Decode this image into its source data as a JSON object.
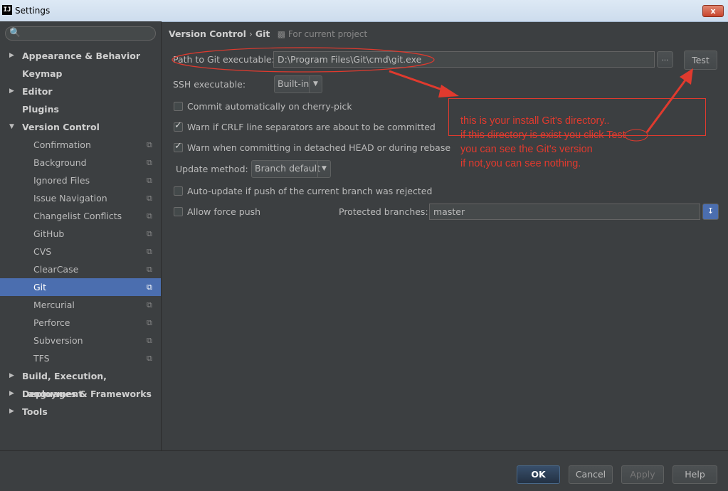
{
  "window": {
    "title": "Settings",
    "app_icon": "IJ",
    "close_label": "x"
  },
  "search": {
    "placeholder": ""
  },
  "sidebar": {
    "items": [
      {
        "label": "Appearance & Behavior",
        "level": 1,
        "arrow": "▶"
      },
      {
        "label": "Keymap",
        "level": 1,
        "arrow": ""
      },
      {
        "label": "Editor",
        "level": 1,
        "arrow": "▶"
      },
      {
        "label": "Plugins",
        "level": 1,
        "arrow": ""
      },
      {
        "label": "Version Control",
        "level": 1,
        "arrow": "▼"
      },
      {
        "label": "Confirmation",
        "level": 2
      },
      {
        "label": "Background",
        "level": 2
      },
      {
        "label": "Ignored Files",
        "level": 2
      },
      {
        "label": "Issue Navigation",
        "level": 2
      },
      {
        "label": "Changelist Conflicts",
        "level": 2
      },
      {
        "label": "GitHub",
        "level": 2
      },
      {
        "label": "CVS",
        "level": 2
      },
      {
        "label": "ClearCase",
        "level": 2
      },
      {
        "label": "Git",
        "level": 2,
        "selected": true
      },
      {
        "label": "Mercurial",
        "level": 2
      },
      {
        "label": "Perforce",
        "level": 2
      },
      {
        "label": "Subversion",
        "level": 2
      },
      {
        "label": "TFS",
        "level": 2
      },
      {
        "label": "Build, Execution, Deployment",
        "level": 1,
        "arrow": "▶"
      },
      {
        "label": "Languages & Frameworks",
        "level": 1,
        "arrow": "▶"
      },
      {
        "label": "Tools",
        "level": 1,
        "arrow": "▶"
      }
    ]
  },
  "breadcrumb": {
    "part1": "Version Control",
    "sep": "›",
    "part2": "Git",
    "scope": "For current project"
  },
  "git": {
    "path_label": "Path to Git executable:",
    "path_value": "D:\\Program Files\\Git\\cmd\\git.exe",
    "browse_label": "...",
    "test_label": "Test",
    "ssh_label": "SSH executable:",
    "ssh_value": "Built-in",
    "commit_cherry_label": "Commit automatically on cherry-pick",
    "commit_cherry_checked": false,
    "crlf_label": "Warn if CRLF line separators are about to be committed",
    "crlf_checked": true,
    "detached_label": "Warn when committing in detached HEAD or during rebase",
    "detached_checked": true,
    "update_method_label": "Update method:",
    "update_method_value": "Branch default",
    "autoupdate_label": "Auto-update if push of the current branch was rejected",
    "autoupdate_checked": false,
    "force_push_label": "Allow force push",
    "force_push_checked": false,
    "protected_label": "Protected branches:",
    "protected_value": "master"
  },
  "annotation": {
    "text": "this is your install Git's directory..\nif this directory is exist you click Test\nyou can see the Git's version\nif not,you can see nothing.",
    "color": "#e03a2e"
  },
  "buttons": {
    "ok": "OK",
    "cancel": "Cancel",
    "apply": "Apply",
    "help": "Help"
  },
  "colors": {
    "background": "#3c3f41",
    "selection": "#4b6eaf",
    "text": "#bbbbbb"
  }
}
